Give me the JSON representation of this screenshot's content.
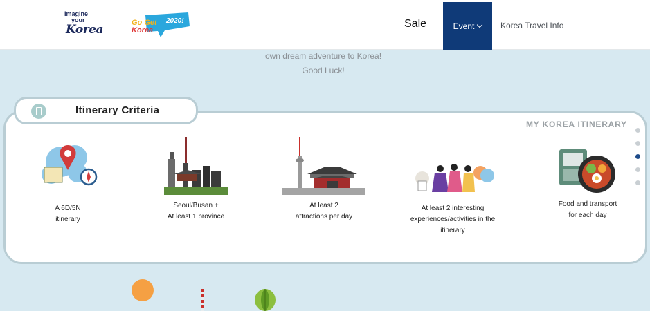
{
  "header": {
    "logo_imagine": {
      "line1": "Imagine",
      "line2": "your",
      "line3": "Korea"
    },
    "logo_gogetkorea": {
      "line1": "Go Get",
      "line2": "Korea",
      "line3": "2020!"
    },
    "nav": {
      "sale": "Sale",
      "event": "Event",
      "korea_travel_info": "Korea Travel Info"
    },
    "event_bg_color": "#0f3a78"
  },
  "intro": {
    "line1": "own dream adventure to Korea!",
    "line2": "Good Luck!"
  },
  "criteria": {
    "tab_title": "Itinerary Criteria",
    "side_label": "MY KOREA ITINERARY",
    "items": [
      {
        "icon": "map-pin-compass-icon",
        "line1": "A 6D/5N",
        "line2": "itinerary"
      },
      {
        "icon": "seoul-busan-skyline-icon",
        "line1": "Seoul/Busan +",
        "line2": "At least 1 province"
      },
      {
        "icon": "tower-palace-icon",
        "line1": "At least 2",
        "line2": "attractions per day"
      },
      {
        "icon": "people-activities-icon",
        "line1": "At least 2 interesting",
        "line2": "experiences/activities in the",
        "line3": "itinerary"
      },
      {
        "icon": "food-transport-card-icon",
        "line1": "Food and transport",
        "line2": "for each day"
      }
    ]
  },
  "pager": {
    "count": 5,
    "active_index": 2
  }
}
